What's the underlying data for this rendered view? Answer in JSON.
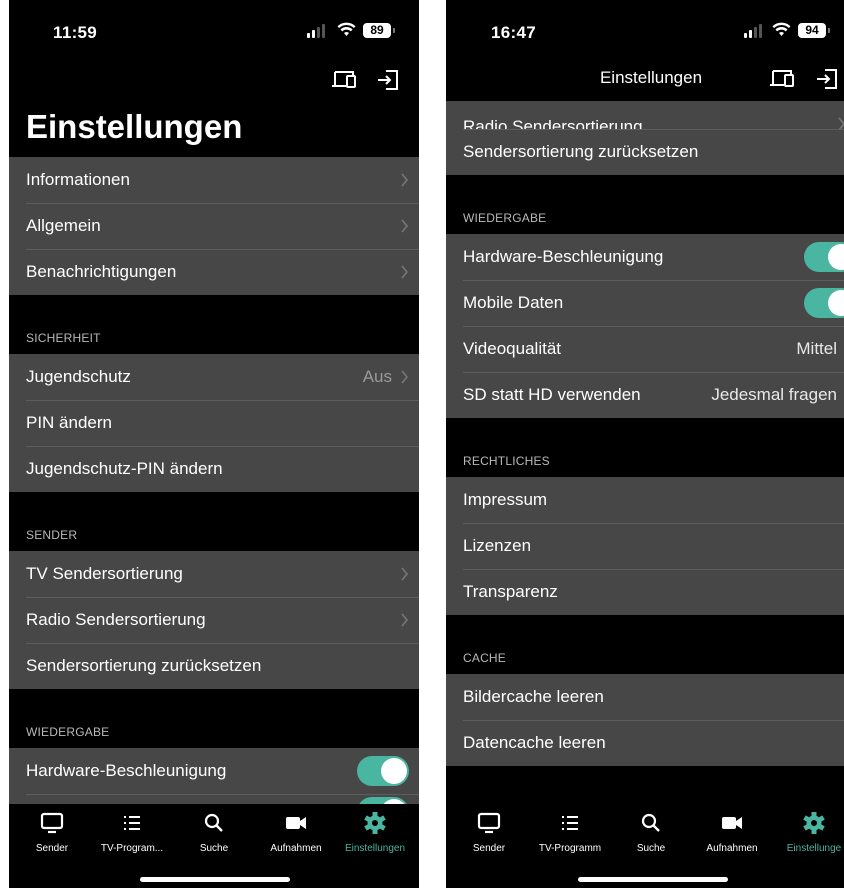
{
  "left": {
    "status": {
      "time": "11:59",
      "battery": "89"
    },
    "title": "Einstellungen",
    "groups": [
      {
        "header": "",
        "rows": [
          {
            "label": "Informationen",
            "value": ""
          },
          {
            "label": "Allgemein",
            "value": ""
          },
          {
            "label": "Benachrichtigungen",
            "value": ""
          }
        ]
      },
      {
        "header": "SICHERHEIT",
        "rows": [
          {
            "label": "Jugendschutz",
            "value": "Aus"
          },
          {
            "label": "PIN ändern",
            "value": ""
          },
          {
            "label": "Jugendschutz-PIN ändern",
            "value": ""
          }
        ]
      },
      {
        "header": "SENDER",
        "rows": [
          {
            "label": "TV Sendersortierung",
            "value": ""
          },
          {
            "label": "Radio Sendersortierung",
            "value": ""
          },
          {
            "label": "Sendersortierung zurücksetzen",
            "value": ""
          }
        ]
      },
      {
        "header": "WIEDERGABE",
        "rows": [
          {
            "label": "Hardware-Beschleunigung",
            "toggle": "on"
          }
        ]
      }
    ],
    "tabs": [
      {
        "label": "Sender",
        "icon": "tv-icon"
      },
      {
        "label": "TV-Program...",
        "icon": "list-icon"
      },
      {
        "label": "Suche",
        "icon": "search-icon"
      },
      {
        "label": "Aufnahmen",
        "icon": "video-camera-icon"
      },
      {
        "label": "Einstellungen",
        "icon": "gear-icon",
        "active": true
      }
    ]
  },
  "right": {
    "status": {
      "time": "16:47",
      "battery": "94"
    },
    "title": "Einstellungen",
    "partial_row": "Radio Sendersortierung",
    "rows_top": [
      {
        "label": "Sendersortierung zurücksetzen",
        "value": ""
      }
    ],
    "groups": [
      {
        "header": "WIEDERGABE",
        "rows": [
          {
            "label": "Hardware-Beschleunigung",
            "toggle": "on"
          },
          {
            "label": "Mobile Daten",
            "toggle": "on"
          },
          {
            "label": "Videoqualität",
            "value": "Mittel"
          },
          {
            "label": "SD statt HD verwenden",
            "value": "Jedesmal fragen"
          }
        ]
      },
      {
        "header": "RECHTLICHES",
        "rows": [
          {
            "label": "Impressum",
            "value": ""
          },
          {
            "label": "Lizenzen",
            "value": ""
          },
          {
            "label": "Transparenz",
            "value": ""
          }
        ]
      },
      {
        "header": "CACHE",
        "rows": [
          {
            "label": "Bildercache leeren",
            "value": ""
          },
          {
            "label": "Datencache leeren",
            "value": ""
          }
        ]
      }
    ],
    "tabs": [
      {
        "label": "Sender",
        "icon": "tv-icon"
      },
      {
        "label": "TV-Programm",
        "icon": "list-icon"
      },
      {
        "label": "Suche",
        "icon": "search-icon"
      },
      {
        "label": "Aufnahmen",
        "icon": "video-camera-icon"
      },
      {
        "label": "Einstellunge",
        "icon": "gear-icon",
        "active": true
      }
    ]
  },
  "colors": {
    "accent": "#4ab5a0",
    "row": "#474747",
    "background": "#000000"
  }
}
